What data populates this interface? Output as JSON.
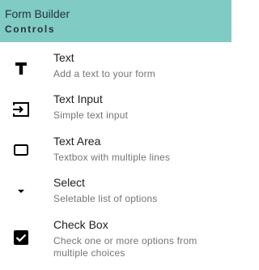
{
  "header": {
    "title": "Form Builder",
    "subtitle": "Controls"
  },
  "items": [
    {
      "label": "Text",
      "description": "Add a text to your form",
      "icon": "text-format-icon"
    },
    {
      "label": "Text Input",
      "description": "Simple text input",
      "icon": "input-icon"
    },
    {
      "label": "Text Area",
      "description": "Textbox with multiple lines",
      "icon": "textarea-icon"
    },
    {
      "label": "Select",
      "description": "Seletable list of options",
      "icon": "dropdown-arrow-icon"
    },
    {
      "label": "Check Box",
      "description": "Check one or more options from multiple choices",
      "icon": "checkbox-checked-icon"
    }
  ],
  "colors": {
    "header_bg": "#80cbc4",
    "text_primary": "#212121",
    "text_secondary": "#757575"
  }
}
